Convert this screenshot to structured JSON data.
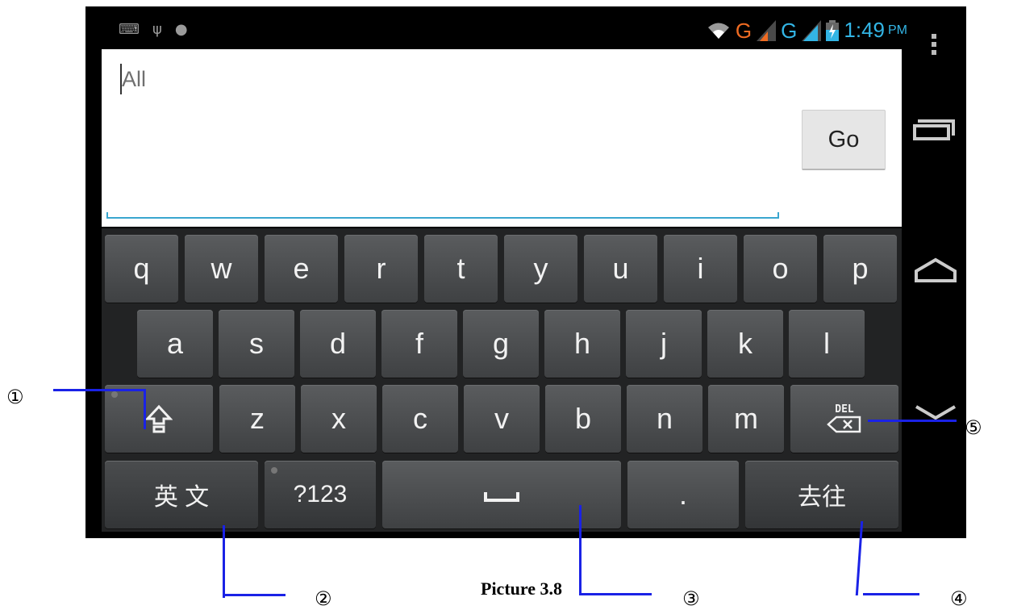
{
  "status_bar": {
    "left_icons": [
      "keyboard-icon",
      "usb-icon",
      "android-debug-icon"
    ],
    "net_label_1": "G",
    "net_label_2": "G",
    "time": "1:49",
    "ampm": "PM"
  },
  "input": {
    "value": "All"
  },
  "go_button": {
    "label": "Go"
  },
  "keyboard": {
    "row1": [
      "q",
      "w",
      "e",
      "r",
      "t",
      "y",
      "u",
      "i",
      "o",
      "p"
    ],
    "row2": [
      "a",
      "s",
      "d",
      "f",
      "g",
      "h",
      "j",
      "k",
      "l"
    ],
    "row3": [
      "z",
      "x",
      "c",
      "v",
      "b",
      "n",
      "m"
    ],
    "shift_label": "⇧",
    "del_label": "DEL",
    "lang_label": "英 文",
    "symbols_label": "?123",
    "space_label": "⎵",
    "period_label": ".",
    "enter_label": "去往"
  },
  "callouts": [
    "①",
    "②",
    "③",
    "④",
    "⑤"
  ],
  "caption": "Picture 3.8"
}
